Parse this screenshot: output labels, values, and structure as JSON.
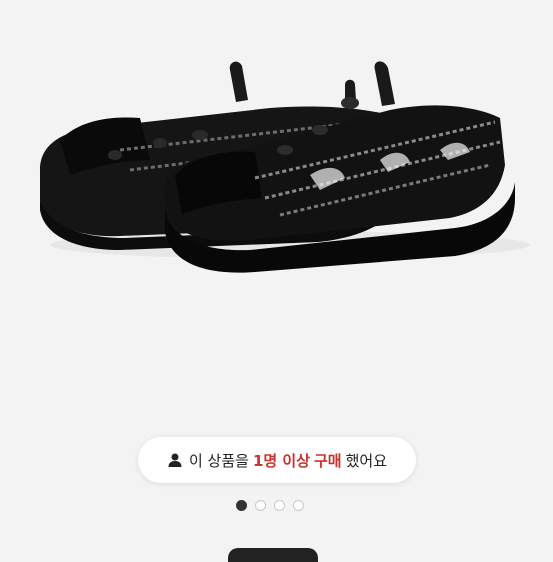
{
  "badge": {
    "icon": "user-icon",
    "part1": "이 상품을",
    "count": "1명 이상",
    "action": "구매",
    "part2": "했어요"
  },
  "carousel": {
    "total": 4,
    "active_index": 0
  }
}
